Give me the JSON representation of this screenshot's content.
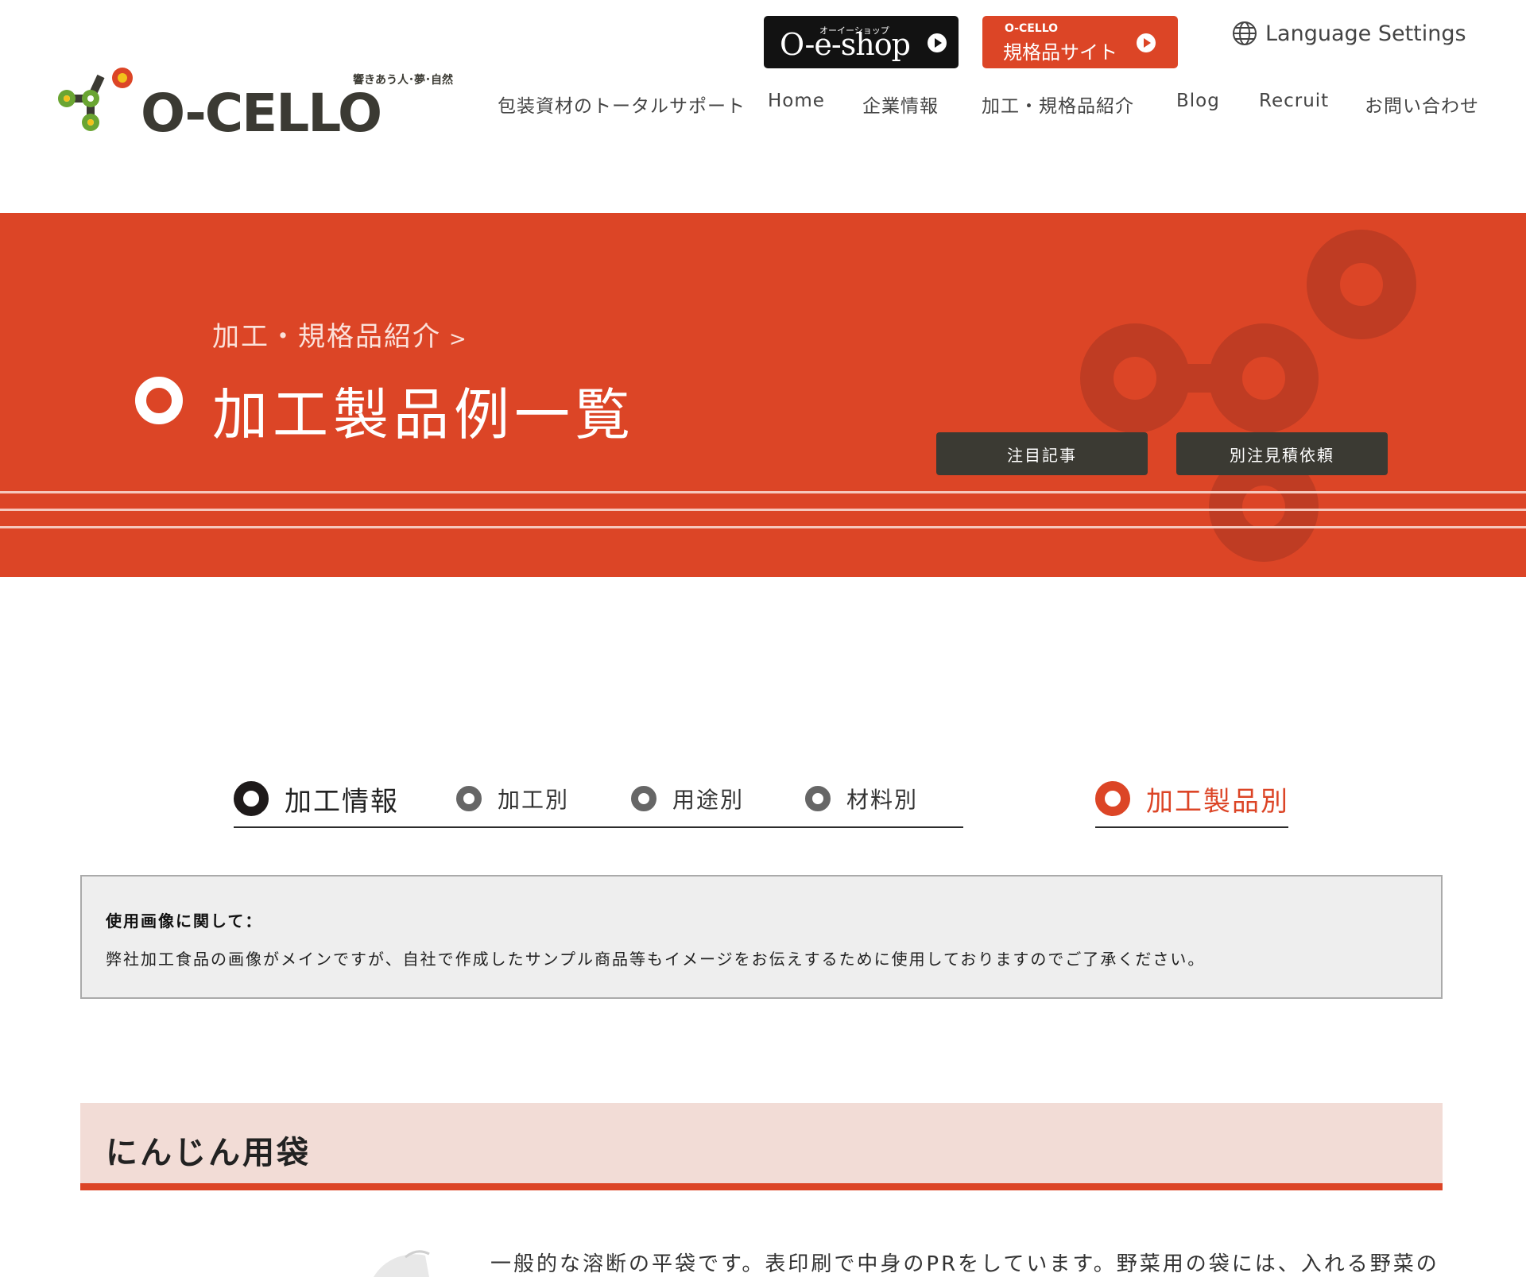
{
  "header": {
    "logo_text": "O-CELLO",
    "logo_tagline": "響きあう人･夢･自然",
    "eshop": {
      "small": "オーイーショップ",
      "label": "O-e-shop"
    },
    "standard_site": {
      "small": "O-CELLO",
      "label": "規格品サイト"
    },
    "language": "Language Settings",
    "nav": [
      "包装資材のトータルサポート",
      "Home",
      "企業情報",
      "加工・規格品紹介",
      "Blog",
      "Recruit",
      "お問い合わせ"
    ]
  },
  "hero": {
    "breadcrumb": "加工・規格品紹介",
    "breadcrumb_sep": ">",
    "title": "加工製品例一覧",
    "buttons": [
      "注目記事",
      "別注見積依頼"
    ]
  },
  "tabs": {
    "items": [
      "加工情報",
      "加工別",
      "用途別",
      "材料別",
      "加工製品別"
    ]
  },
  "notice": {
    "title": "使用画像に関して：",
    "body": "弊社加工食品の画像がメインですが、自社で作成したサンプル商品等もイメージをお伝えするために使用しておりますのでご了承ください。"
  },
  "section": {
    "title": "にんじん用袋",
    "description": "一般的な溶断の平袋です。表印刷で中身のPRをしています。野菜用の袋には、入れる野菜の"
  },
  "colors": {
    "accent": "#dc4526",
    "dark": "#3b3a33",
    "hero_deco": "#bf3c23"
  }
}
